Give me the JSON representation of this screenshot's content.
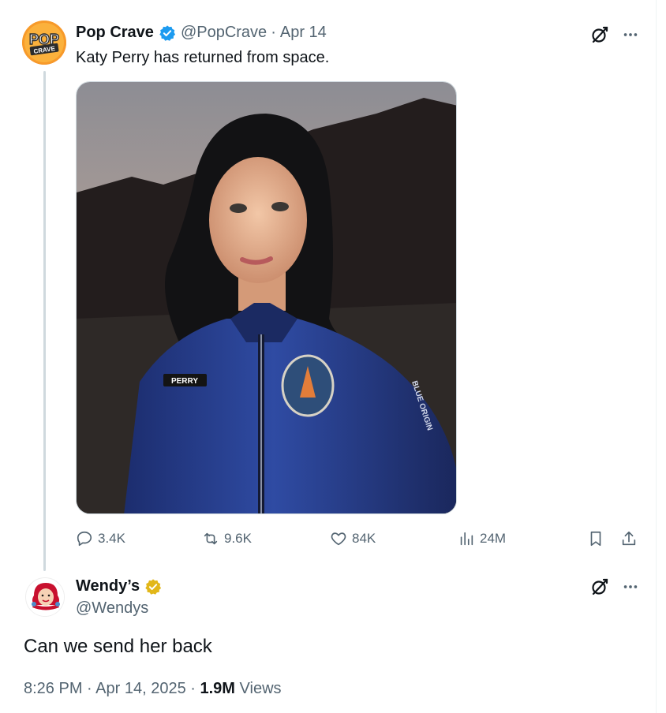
{
  "parent_tweet": {
    "author_name": "Pop Crave",
    "handle": "@PopCrave",
    "separator": "·",
    "date": "Apr 14",
    "text": "Katy Perry has returned from space.",
    "avatar_text_top": "POP",
    "avatar_text_bottom": "CRAVE",
    "image_patch_name": "PERRY",
    "image_sleeve_text": "BLUE ORIGIN",
    "stats": {
      "replies": "3.4K",
      "reposts": "9.6K",
      "likes": "84K",
      "views": "24M"
    },
    "verified_badge_color": "#1d9bf0"
  },
  "reply_tweet": {
    "author_name": "Wendy’s",
    "handle": "@Wendys",
    "text": "Can we send her back",
    "time": "8:26 PM",
    "dot": "·",
    "date": "Apr 14, 2025",
    "views_count": "1.9M",
    "views_label": "Views",
    "verified_badge_color": "#e2b719"
  },
  "icons": {
    "verified": "verified-badge-icon",
    "grok": "grok-icon",
    "more": "more-dots-icon",
    "reply": "reply-icon",
    "repost": "repost-icon",
    "like": "heart-icon",
    "views": "analytics-icon",
    "bookmark": "bookmark-icon",
    "share": "share-icon"
  }
}
